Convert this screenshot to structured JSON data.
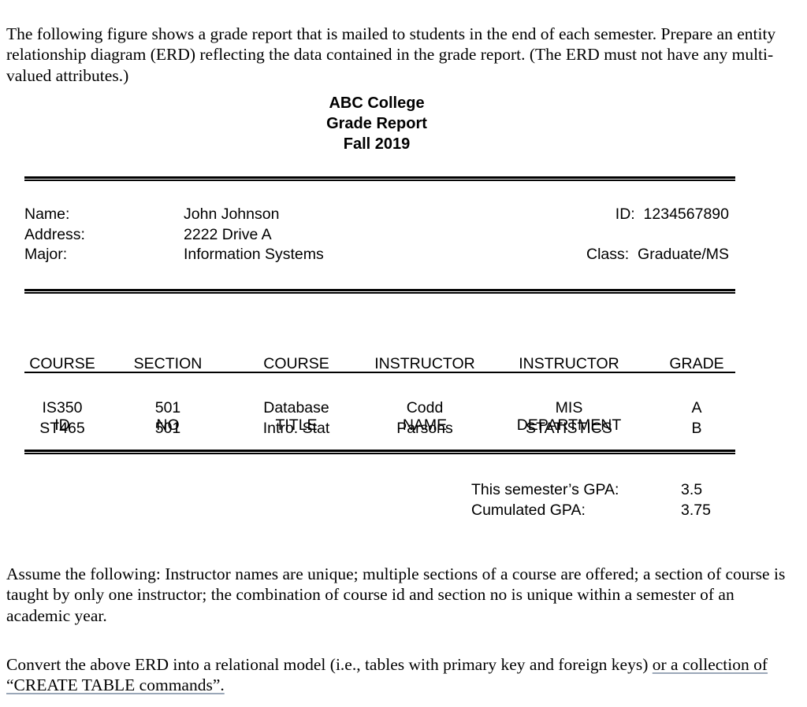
{
  "question": {
    "intro": "The following figure shows a grade report that is mailed to students in the end of each semester. Prepare an entity relationship diagram (ERD) reflecting the data contained in the grade report. (The ERD must not have any multi-valued attributes.)",
    "assumptions": "Assume the following: Instructor names are unique; multiple sections of a course are offered; a section of course is taught by only one instructor; the combination of course id and section no is unique within a semester of an academic year.",
    "convert_plain": "Convert the above ERD into a relational model (i.e., tables with primary key and foreign keys) ",
    "convert_underlined": "or a collection of “CREATE TABLE commands”."
  },
  "report": {
    "title_lines": {
      "institution": "ABC College",
      "document": "Grade Report",
      "term": "Fall 2019"
    },
    "student": {
      "name_label": "Name:",
      "name_value": "John Johnson",
      "address_label": "Address:",
      "address_value": "2222 Drive A",
      "major_label": "Major:",
      "major_value": "Information Systems",
      "id_line": "ID:  1234567890",
      "class_line": "Class:  Graduate/MS"
    },
    "table": {
      "headers": [
        {
          "line1": "COURSE",
          "line2": "ID"
        },
        {
          "line1": "SECTION",
          "line2": "NO"
        },
        {
          "line1": "COURSE",
          "line2": "TITLE"
        },
        {
          "line1": "INSTRUCTOR",
          "line2": "NAME"
        },
        {
          "line1": "INSTRUCTOR",
          "line2": "DEPARTMENT"
        },
        {
          "line1": "GRADE",
          "line2": ""
        }
      ],
      "rows": [
        {
          "course_id": "IS350",
          "section_no": "501",
          "course_title": "Database",
          "instructor_name": "Codd",
          "instructor_department": "MIS",
          "grade": "A"
        },
        {
          "course_id": "ST465",
          "section_no": "501",
          "course_title": "Intro. Stat",
          "instructor_name": "Parsons",
          "instructor_department": "STATISTICS",
          "grade": "B"
        }
      ]
    },
    "gpa": {
      "semester_label": "This semester’s GPA:",
      "semester_value": "3.5",
      "cumulated_label": "Cumulated GPA:",
      "cumulated_value": "3.75"
    }
  },
  "colors": {
    "text": "#000000",
    "rule": "#000000",
    "underline": "#9aa7b8",
    "page_background": "#ffffff"
  }
}
